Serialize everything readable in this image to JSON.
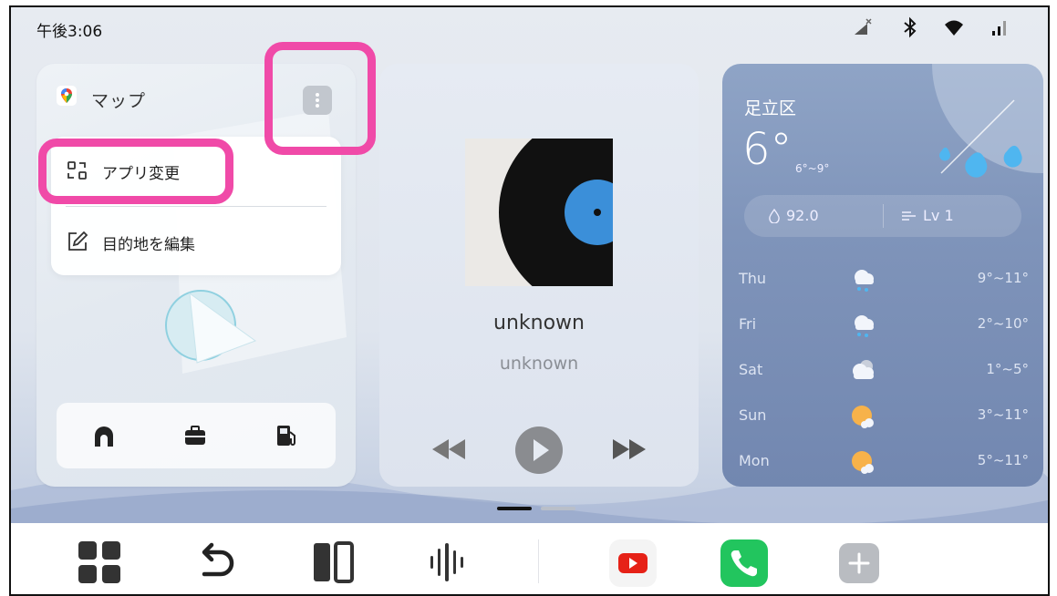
{
  "status_bar": {
    "time": "午後3:06",
    "icons": [
      "no-signal-icon",
      "bluetooth-icon",
      "wifi-icon",
      "cell-signal-icon"
    ]
  },
  "map_card": {
    "title": "マップ",
    "menu": {
      "change_app": "アプリ変更",
      "edit_destination": "目的地を編集"
    },
    "shortcuts": [
      "home-icon",
      "briefcase-icon",
      "gas-station-icon"
    ]
  },
  "music_card": {
    "title": "unknown",
    "artist": "unknown",
    "controls": [
      "previous-icon",
      "play-icon",
      "next-icon"
    ]
  },
  "weather_card": {
    "city": "足立区",
    "temperature": "6°",
    "range": "6°~9°",
    "humidity": "92.0",
    "wind": "Lv 1",
    "forecast": [
      {
        "day": "Thu",
        "icon": "rain-cloud-icon",
        "temp": "9°~11°"
      },
      {
        "day": "Fri",
        "icon": "rain-cloud-icon",
        "temp": "2°~10°"
      },
      {
        "day": "Sat",
        "icon": "cloudy-icon",
        "temp": "1°~5°"
      },
      {
        "day": "Sun",
        "icon": "partly-sunny-icon",
        "temp": "3°~11°"
      },
      {
        "day": "Mon",
        "icon": "partly-sunny-icon",
        "temp": "5°~11°"
      }
    ]
  },
  "dock": {
    "items": [
      "apps-grid-icon",
      "back-icon",
      "split-screen-icon",
      "voice-assistant-icon",
      "youtube-icon",
      "phone-icon",
      "add-icon"
    ]
  },
  "colors": {
    "highlight": "#f04aa8",
    "youtube": "#e62117",
    "phone": "#22c55e",
    "weather_bg": "#7f94ba"
  }
}
